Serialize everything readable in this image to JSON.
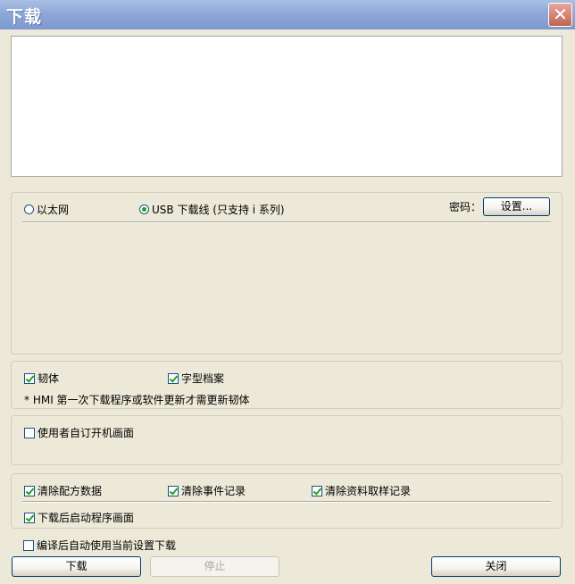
{
  "window": {
    "title": "下载",
    "close_glyph": "✕"
  },
  "connection": {
    "ethernet_label": "以太网",
    "ethernet_selected": false,
    "usb_label": "USB 下载线 (只支持 i 系列)",
    "usb_selected": true,
    "password_label": "密码：",
    "settings_button": "设置..."
  },
  "firmware": {
    "firmware_label": "韧体",
    "firmware_checked": true,
    "font_file_label": "字型档案",
    "font_file_checked": true,
    "note": "* HMI 第一次下载程序或软件更新才需更新韧体"
  },
  "startup": {
    "custom_boot_label": "使用者自订开机画面",
    "custom_boot_checked": false
  },
  "clear": {
    "recipe_label": "清除配方数据",
    "recipe_checked": true,
    "event_label": "清除事件记录",
    "event_checked": true,
    "sampling_label": "清除资料取样记录",
    "sampling_checked": true,
    "restart_label": "下载后启动程序画面",
    "restart_checked": true
  },
  "auto_download": {
    "label": "编译后自动使用当前设置下载",
    "checked": false
  },
  "buttons": {
    "download": "下载",
    "stop": "停止",
    "close": "关闭"
  }
}
